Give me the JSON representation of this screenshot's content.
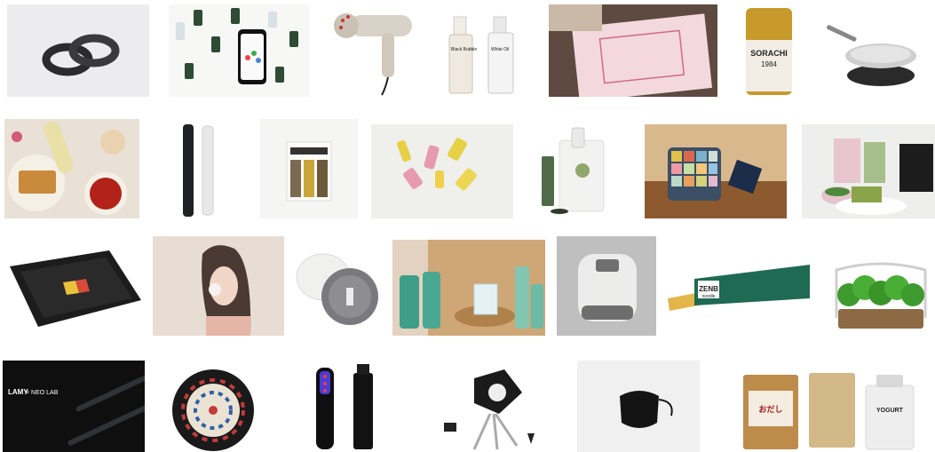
{
  "grid": {
    "background": "#ffffff",
    "tiles": [
      {
        "id": "smart-ring",
        "icon": "ring-icon"
      },
      {
        "id": "droppers-phone",
        "icon": "dropper-bottles-icon"
      },
      {
        "id": "hair-dryer",
        "icon": "hair-dryer-icon"
      },
      {
        "id": "serum-bottles",
        "icon": "bottles-icon",
        "text": [
          "Black Bubble",
          "White Oil"
        ]
      },
      {
        "id": "pink-box",
        "icon": "gift-box-icon"
      },
      {
        "id": "beer-can",
        "icon": "beer-can-icon",
        "text": [
          "SORACHI",
          "1984"
        ]
      },
      {
        "id": "smart-pan",
        "icon": "frying-pan-icon"
      },
      {
        "id": "food-table",
        "icon": "food-platter-icon"
      },
      {
        "id": "wand-devices",
        "icon": "wand-icon"
      },
      {
        "id": "color-card",
        "icon": "color-swatch-icon"
      },
      {
        "id": "cosmetic-tubes",
        "icon": "tubes-icon"
      },
      {
        "id": "tea-machine",
        "icon": "tea-machine-icon"
      },
      {
        "id": "colorful-tray",
        "icon": "tray-icon"
      },
      {
        "id": "matcha-set",
        "icon": "matcha-icon"
      },
      {
        "id": "game-board",
        "icon": "board-game-icon"
      },
      {
        "id": "woman-device",
        "icon": "beauty-device-icon"
      },
      {
        "id": "powder-compact",
        "icon": "compact-icon"
      },
      {
        "id": "bath-products",
        "icon": "bath-bottles-icon"
      },
      {
        "id": "cooker-device",
        "icon": "appliance-icon"
      },
      {
        "id": "pasta-pack",
        "icon": "pasta-icon",
        "text": [
          "ZENB",
          "noodle"
        ]
      },
      {
        "id": "herb-planter",
        "icon": "plant-icon"
      },
      {
        "id": "lamy-pens",
        "icon": "pen-icon",
        "text": [
          "LAMY",
          "× NEO LAB"
        ]
      },
      {
        "id": "dartboard",
        "icon": "dartboard-icon"
      },
      {
        "id": "led-device",
        "icon": "led-brush-icon"
      },
      {
        "id": "camera-tripod",
        "icon": "camera-icon"
      },
      {
        "id": "black-mask",
        "icon": "face-mask-icon"
      },
      {
        "id": "food-bags",
        "icon": "food-bags-icon",
        "text": [
          "おだし",
          "YOGURT"
        ]
      }
    ]
  }
}
